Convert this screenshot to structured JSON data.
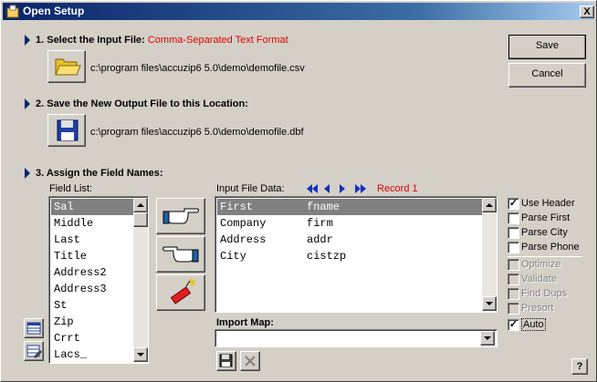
{
  "window": {
    "title": "Open Setup",
    "close_label": "X",
    "help_label": "?"
  },
  "step1": {
    "label": "1. Select the Input File:",
    "format": "Comma-Separated Text Format",
    "path": "c:\\program files\\accuzip6 5.0\\demo\\demofile.csv"
  },
  "step2": {
    "label": "2. Save the New Output File to this Location:",
    "path": "c:\\program files\\accuzip6 5.0\\demo\\demofile.dbf"
  },
  "step3": {
    "label": "3. Assign the Field Names:",
    "field_list_label": "Field List:",
    "field_list": [
      "Sal",
      "Middle",
      "Last",
      "Title",
      "Address2",
      "Address3",
      "St",
      "Zip",
      "Crrt",
      "Lacs_"
    ],
    "input_data_label": "Input File Data:",
    "record_label": "Record 1",
    "input_data": [
      {
        "field": "First",
        "value": "fname"
      },
      {
        "field": "Company",
        "value": "firm"
      },
      {
        "field": "Address",
        "value": "addr"
      },
      {
        "field": "City",
        "value": "cistzp"
      }
    ],
    "import_map_label": "Import Map:",
    "import_map_value": ""
  },
  "buttons": {
    "save": "Save",
    "cancel": "Cancel"
  },
  "options": [
    {
      "label": "Use Header",
      "checked": true,
      "enabled": true
    },
    {
      "label": "Parse First",
      "checked": false,
      "enabled": true
    },
    {
      "label": "Parse City",
      "checked": false,
      "enabled": true
    },
    {
      "label": "Parse Phone",
      "checked": false,
      "enabled": true
    },
    {
      "label": "Optimize",
      "checked": false,
      "enabled": false
    },
    {
      "label": "Validate",
      "checked": false,
      "enabled": false
    },
    {
      "label": "Find Dups",
      "checked": false,
      "enabled": false
    },
    {
      "label": "Presort",
      "checked": false,
      "enabled": false
    },
    {
      "label": "Auto",
      "checked": true,
      "enabled": true
    }
  ],
  "colors": {
    "accent": "#0a246a",
    "format_text": "#e00000",
    "selection": "#808080"
  }
}
